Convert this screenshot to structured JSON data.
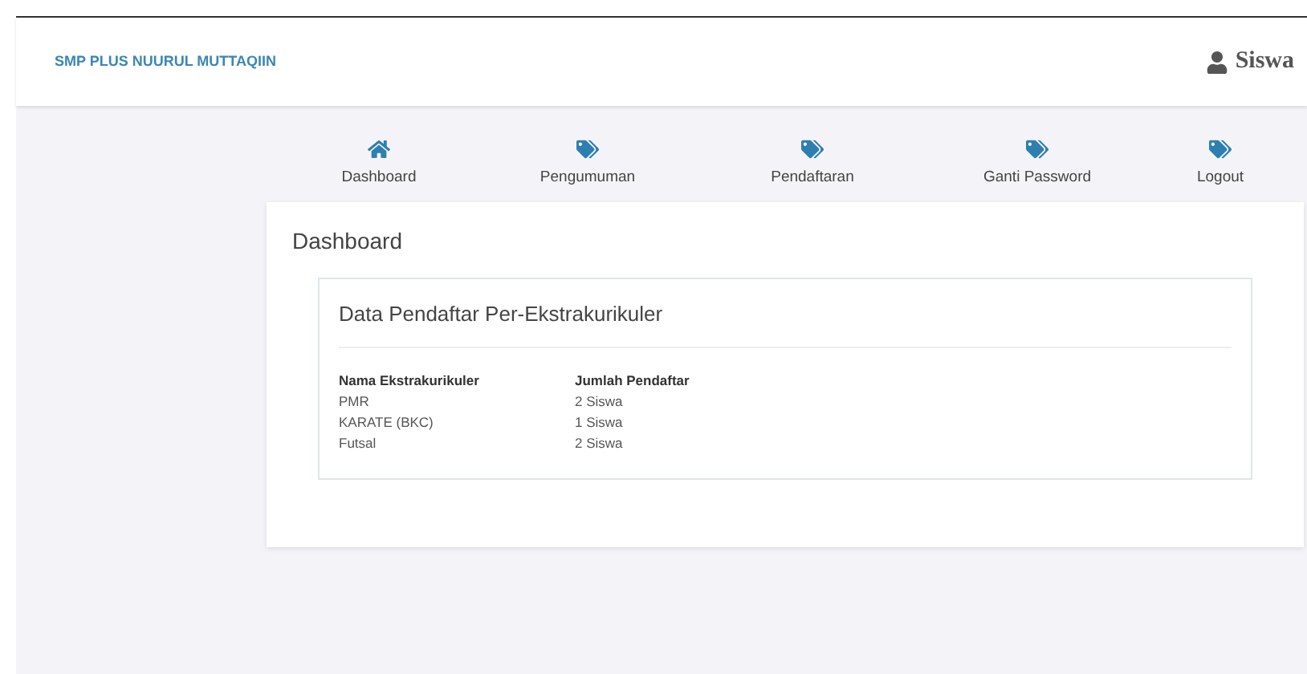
{
  "brand": "SMP PLUS NUURUL MUTTAQIIN",
  "user": {
    "label": "Siswa"
  },
  "nav": [
    {
      "label": "Dashboard",
      "kind": "home"
    },
    {
      "label": "Pengumuman",
      "kind": "tag"
    },
    {
      "label": "Pendaftaran",
      "kind": "tag"
    },
    {
      "label": "Ganti Password",
      "kind": "tag"
    },
    {
      "label": "Logout",
      "kind": "tag"
    }
  ],
  "page_title": "Dashboard",
  "panel": {
    "title": "Data Pendaftar Per-Ekstrakurikuler",
    "columns": [
      "Nama Ekstrakurikuler",
      "Jumlah Pendaftar"
    ],
    "rows": [
      [
        "PMR",
        "2 Siswa"
      ],
      [
        "KARATE (BKC)",
        "1 Siswa"
      ],
      [
        "Futsal",
        "2 Siswa"
      ]
    ]
  }
}
